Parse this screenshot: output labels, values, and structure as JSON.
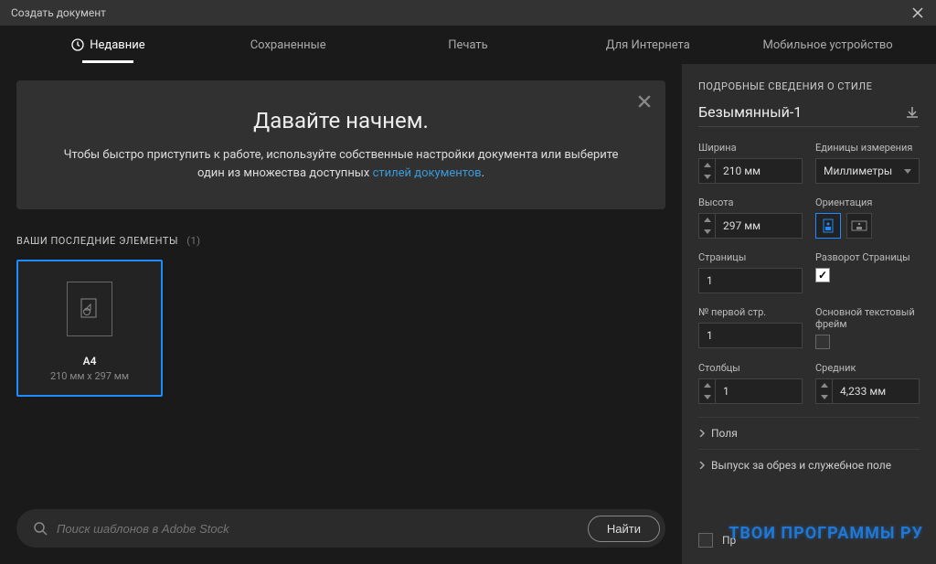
{
  "titlebar": {
    "title": "Создать документ"
  },
  "tabs": {
    "t0": "Недавние",
    "t1": "Сохраненные",
    "t2": "Печать",
    "t3": "Для Интернета",
    "t4": "Мобильное устройство"
  },
  "hero": {
    "title": "Давайте начнем.",
    "text_part1": "Чтобы быстро приступить к работе, используйте собственные настройки документа или выберите один из множества доступных ",
    "link": "стилей документов",
    "period": "."
  },
  "recent": {
    "label": "ВАШИ ПОСЛЕДНИЕ ЭЛЕМЕНТЫ",
    "count": "(1)",
    "preset0": {
      "name": "A4",
      "dims": "210 мм x 297 мм"
    }
  },
  "search": {
    "placeholder": "Поиск шаблонов в Adobe Stock",
    "button": "Найти"
  },
  "panel": {
    "header": "ПОДРОБНЫЕ СВЕДЕНИЯ О СТИЛЕ",
    "doc_name": "Безымянный-1",
    "width_label": "Ширина",
    "width_value": "210 мм",
    "units_label": "Единицы измерения",
    "units_value": "Миллиметры",
    "height_label": "Высота",
    "height_value": "297 мм",
    "orientation_label": "Ориентация",
    "pages_label": "Страницы",
    "pages_value": "1",
    "spread_label": "Разворот Страницы",
    "first_page_label": "№ первой стр.",
    "first_page_value": "1",
    "primary_tf_label": "Основной текстовый фрейм",
    "columns_label": "Столбцы",
    "columns_value": "1",
    "gutter_label": "Средник",
    "gutter_value": "4,233 мм",
    "margins": "Поля",
    "bleed": "Выпуск за обрез и служебное поле",
    "preview_label": "Пр",
    "watermark": "ТВОИ ПРОГРАММЫ РУ"
  }
}
